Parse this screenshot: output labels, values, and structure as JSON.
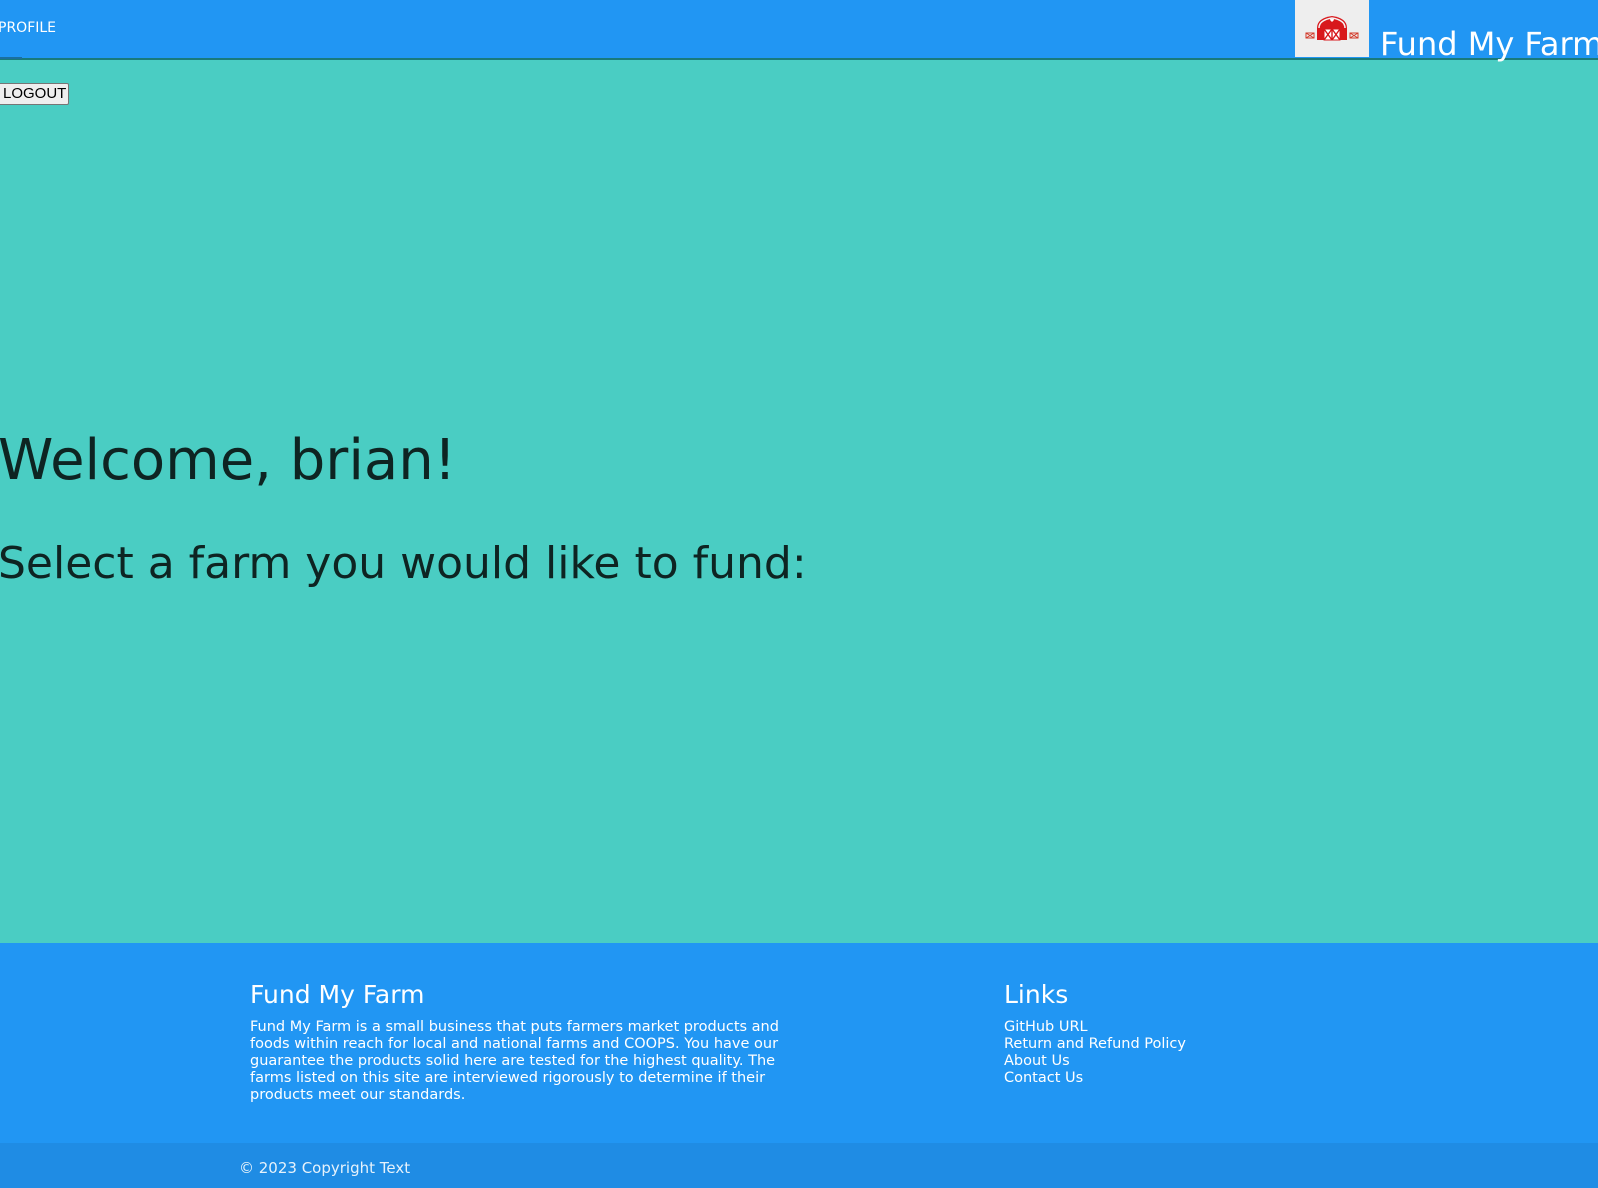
{
  "header": {
    "profile_label": "PROFILE",
    "brand_title": "Fund My Farm",
    "logo_icon": "barn-icon",
    "background_color": "#2196f3"
  },
  "main": {
    "logout_label": "LOGOUT",
    "welcome_heading": "Welcome, brian!",
    "select_prompt": "Select a farm you would like to fund:",
    "background_color": "#4acdc3"
  },
  "footer": {
    "about_heading": "Fund My Farm",
    "about_text": "Fund My Farm is a small business that puts farmers market products and foods within reach for local and national farms and COOPS. You have our guarantee the products solid here are tested for the highest quality. The farms listed on this site are interviewed rigorously to determine if their products meet our standards.",
    "links_heading": "Links",
    "links": [
      {
        "label": "GitHub URL"
      },
      {
        "label": "Return and Refund Policy"
      },
      {
        "label": "About Us"
      },
      {
        "label": "Contact Us"
      }
    ],
    "copyright": "© 2023 Copyright Text"
  }
}
